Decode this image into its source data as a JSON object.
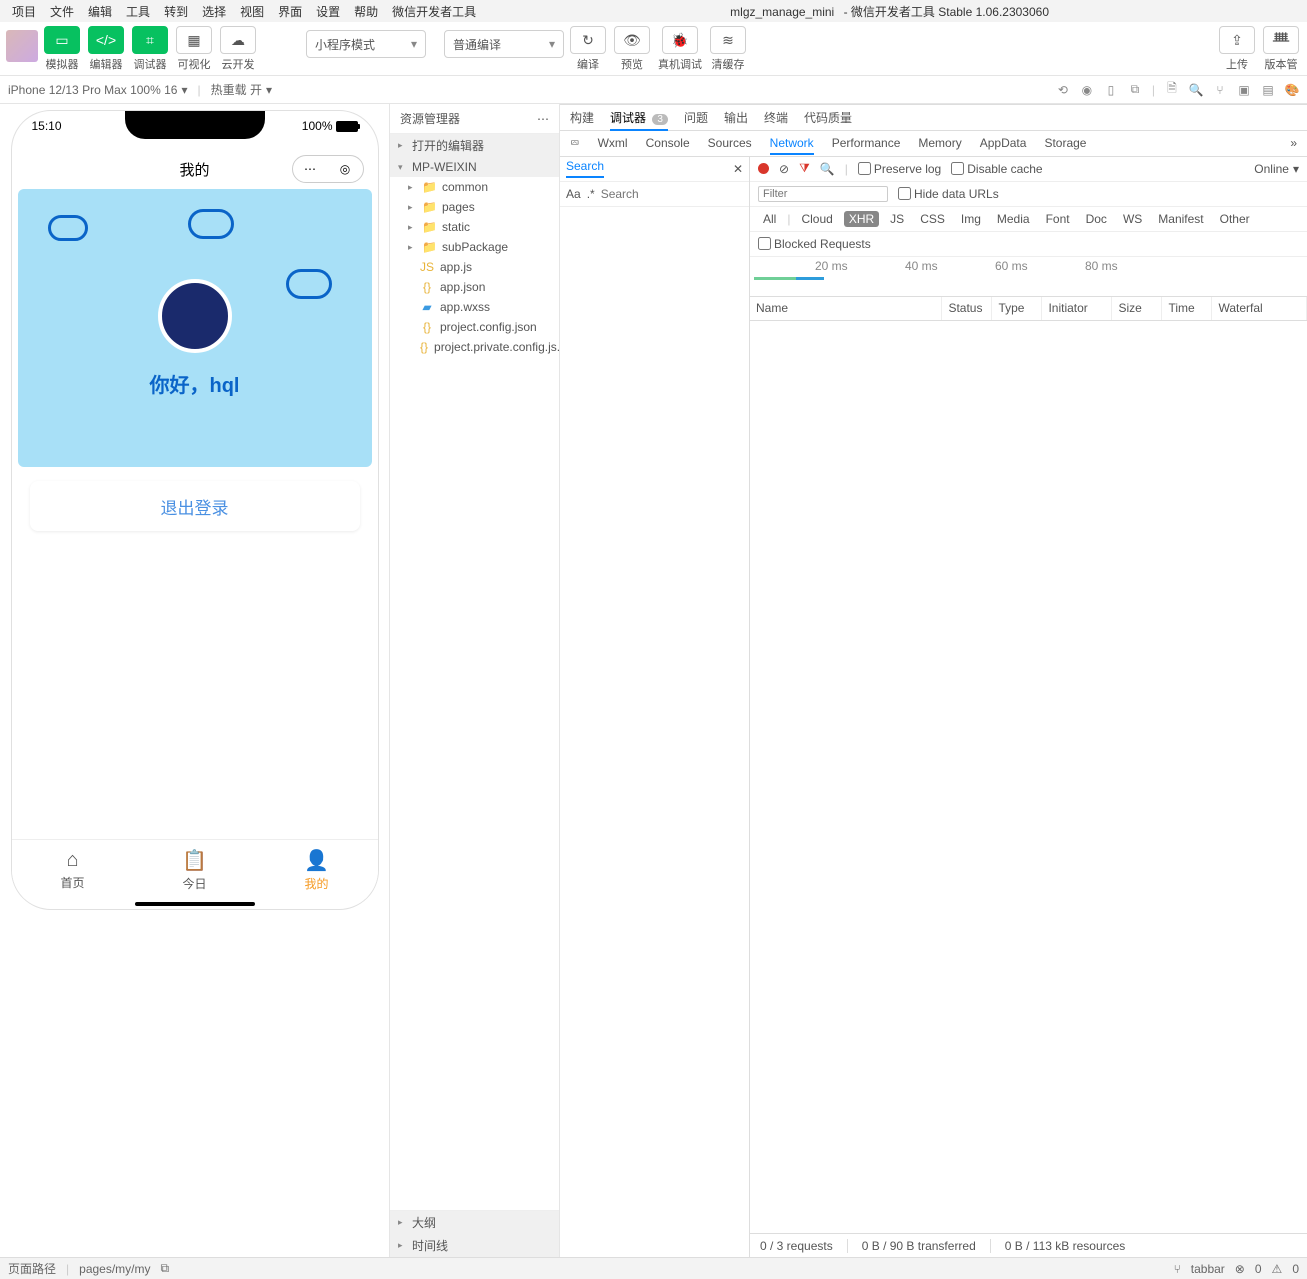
{
  "window": {
    "project": "mlgz_manage_mini",
    "suffix": " - 微信开发者工具 Stable 1.06.2303060"
  },
  "menu": [
    "项目",
    "文件",
    "编辑",
    "工具",
    "转到",
    "选择",
    "视图",
    "界面",
    "设置",
    "帮助",
    "微信开发者工具"
  ],
  "toolbar": {
    "sim": "模拟器",
    "editor": "编辑器",
    "debugger": "调试器",
    "vis": "可视化",
    "cloud": "云开发",
    "mode": "小程序模式",
    "compile_scene": "普通编译",
    "compile": "编译",
    "preview": "预览",
    "realdebug": "真机调试",
    "clearcache": "清缓存",
    "upload": "上传",
    "version": "版本管"
  },
  "simbar": {
    "device": "iPhone 12/13 Pro Max 100% 16",
    "hotreload": "热重载 开"
  },
  "phone": {
    "time": "15:10",
    "battery": "100%",
    "title": "我的",
    "greeting": "你好，hql",
    "logout": "退出登录",
    "tabs": [
      {
        "label": "首页"
      },
      {
        "label": "今日"
      },
      {
        "label": "我的"
      }
    ]
  },
  "explorer": {
    "title": "资源管理器",
    "open_editors": "打开的编辑器",
    "root": "MP-WEIXIN",
    "folders": [
      "common",
      "pages",
      "static",
      "subPackage"
    ],
    "files": [
      "app.js",
      "app.json",
      "app.wxss",
      "project.config.json",
      "project.private.config.js..."
    ],
    "outline": "大纲",
    "timeline": "时间线"
  },
  "devtools": {
    "tabs1": [
      "构建",
      "调试器",
      "问题",
      "输出",
      "终端",
      "代码质量"
    ],
    "badge": "3",
    "tabs2": [
      "Wxml",
      "Console",
      "Sources",
      "Network",
      "Performance",
      "Memory",
      "AppData",
      "Storage"
    ],
    "search": {
      "tab": "Search",
      "placeholder": "Search",
      "aa": "Aa",
      "regex": ".*"
    },
    "network": {
      "preserve": "Preserve log",
      "disable": "Disable cache",
      "online": "Online",
      "filter_placeholder": "Filter",
      "hide": "Hide data URLs",
      "types": [
        "All",
        "Cloud",
        "XHR",
        "JS",
        "CSS",
        "Img",
        "Media",
        "Font",
        "Doc",
        "WS",
        "Manifest",
        "Other"
      ],
      "blocked": "Blocked Requests",
      "ticks": [
        "20 ms",
        "40 ms",
        "60 ms",
        "80 ms"
      ],
      "cols": [
        "Name",
        "Status",
        "Type",
        "Initiator",
        "Size",
        "Time",
        "Waterfal"
      ],
      "status": [
        "0 / 3 requests",
        "0 B / 90 B transferred",
        "0 B / 113 kB resources"
      ]
    }
  },
  "statusbar": {
    "pathlabel": "页面路径",
    "path": "pages/my/my",
    "tabbar": "tabbar",
    "warn": "0",
    "err": "0"
  }
}
